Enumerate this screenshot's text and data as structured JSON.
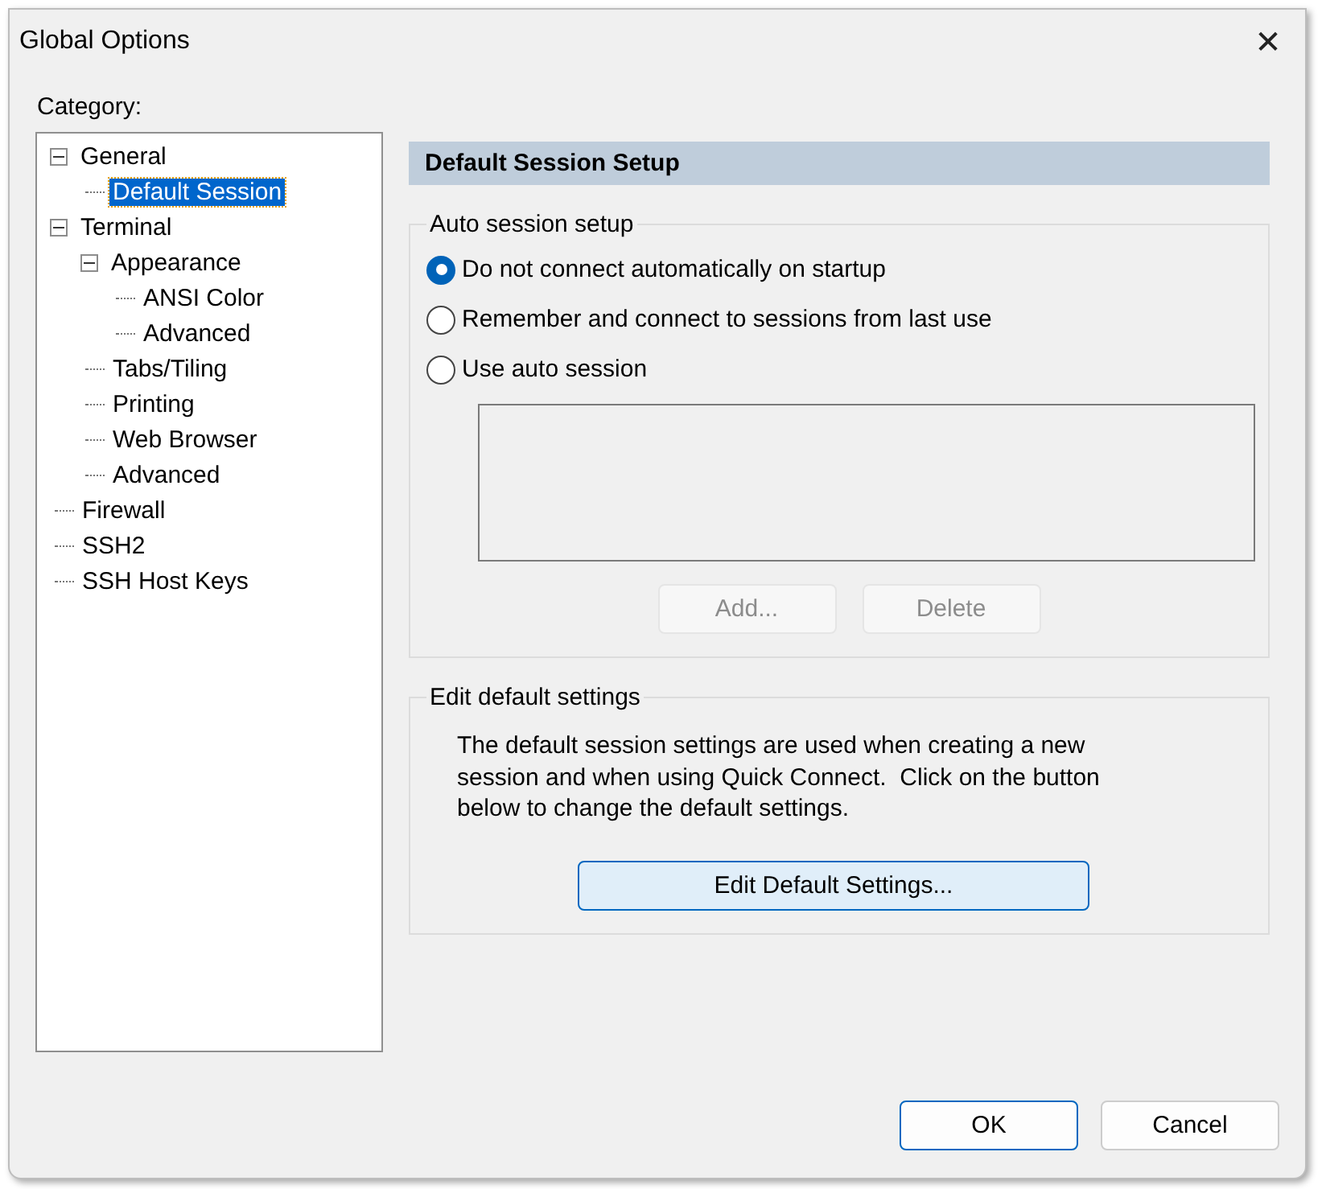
{
  "window": {
    "title": "Global Options",
    "close": "✕"
  },
  "category": {
    "label": "Category:",
    "tree": [
      {
        "label": "General",
        "expanded": true,
        "selected": false,
        "children": [
          {
            "label": "Default Session",
            "selected": true
          }
        ]
      },
      {
        "label": "Terminal",
        "expanded": true,
        "selected": false,
        "children": [
          {
            "label": "Appearance",
            "expanded": true,
            "selected": false,
            "children": [
              {
                "label": "ANSI Color",
                "selected": false
              },
              {
                "label": "Advanced",
                "selected": false
              }
            ]
          },
          {
            "label": "Tabs/Tiling",
            "selected": false
          },
          {
            "label": "Printing",
            "selected": false
          },
          {
            "label": "Web Browser",
            "selected": false
          },
          {
            "label": "Advanced",
            "selected": false
          }
        ]
      },
      {
        "label": "Firewall",
        "selected": false
      },
      {
        "label": "SSH2",
        "selected": false
      },
      {
        "label": "SSH Host Keys",
        "selected": false
      }
    ]
  },
  "panel": {
    "header": "Default Session Setup",
    "auto_session": {
      "title": "Auto session setup",
      "options": [
        {
          "label": "Do not connect automatically on startup",
          "selected": true
        },
        {
          "label": "Remember and connect to sessions from last use",
          "selected": false
        },
        {
          "label": "Use auto session",
          "selected": false
        }
      ],
      "buttons": [
        {
          "label": "Add...",
          "disabled": true
        },
        {
          "label": "Delete",
          "disabled": true
        }
      ]
    },
    "edit_defaults": {
      "title": "Edit default settings",
      "description": "The default session settings are used when creating a new session and when using Quick Connect.  Click on the button below to change the default settings.",
      "button": {
        "label": "Edit Default Settings...",
        "focused": true
      }
    }
  },
  "footer": {
    "buttons": [
      {
        "label": "OK",
        "default": true
      },
      {
        "label": "Cancel",
        "default": false
      }
    ]
  }
}
